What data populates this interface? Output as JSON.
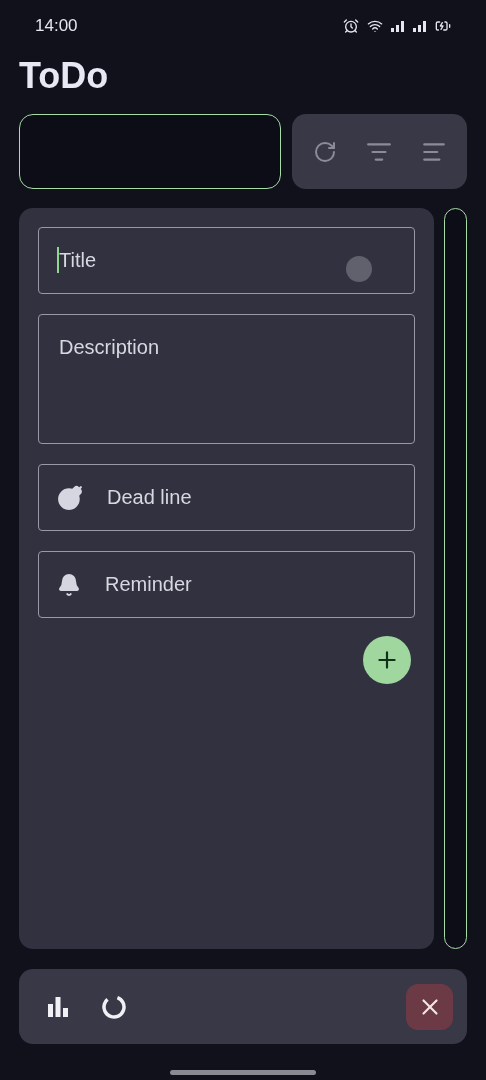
{
  "status_bar": {
    "time": "14:00"
  },
  "app_title": "ToDo",
  "form_fields": [
    {
      "kind": "text",
      "placeholder": "Title",
      "focused": true
    },
    {
      "kind": "multiline",
      "placeholder": "Description",
      "focused": false
    },
    {
      "kind": "deadline",
      "placeholder": "Dead line",
      "focused": false
    },
    {
      "kind": "reminder",
      "placeholder": "Reminder",
      "focused": false
    }
  ]
}
